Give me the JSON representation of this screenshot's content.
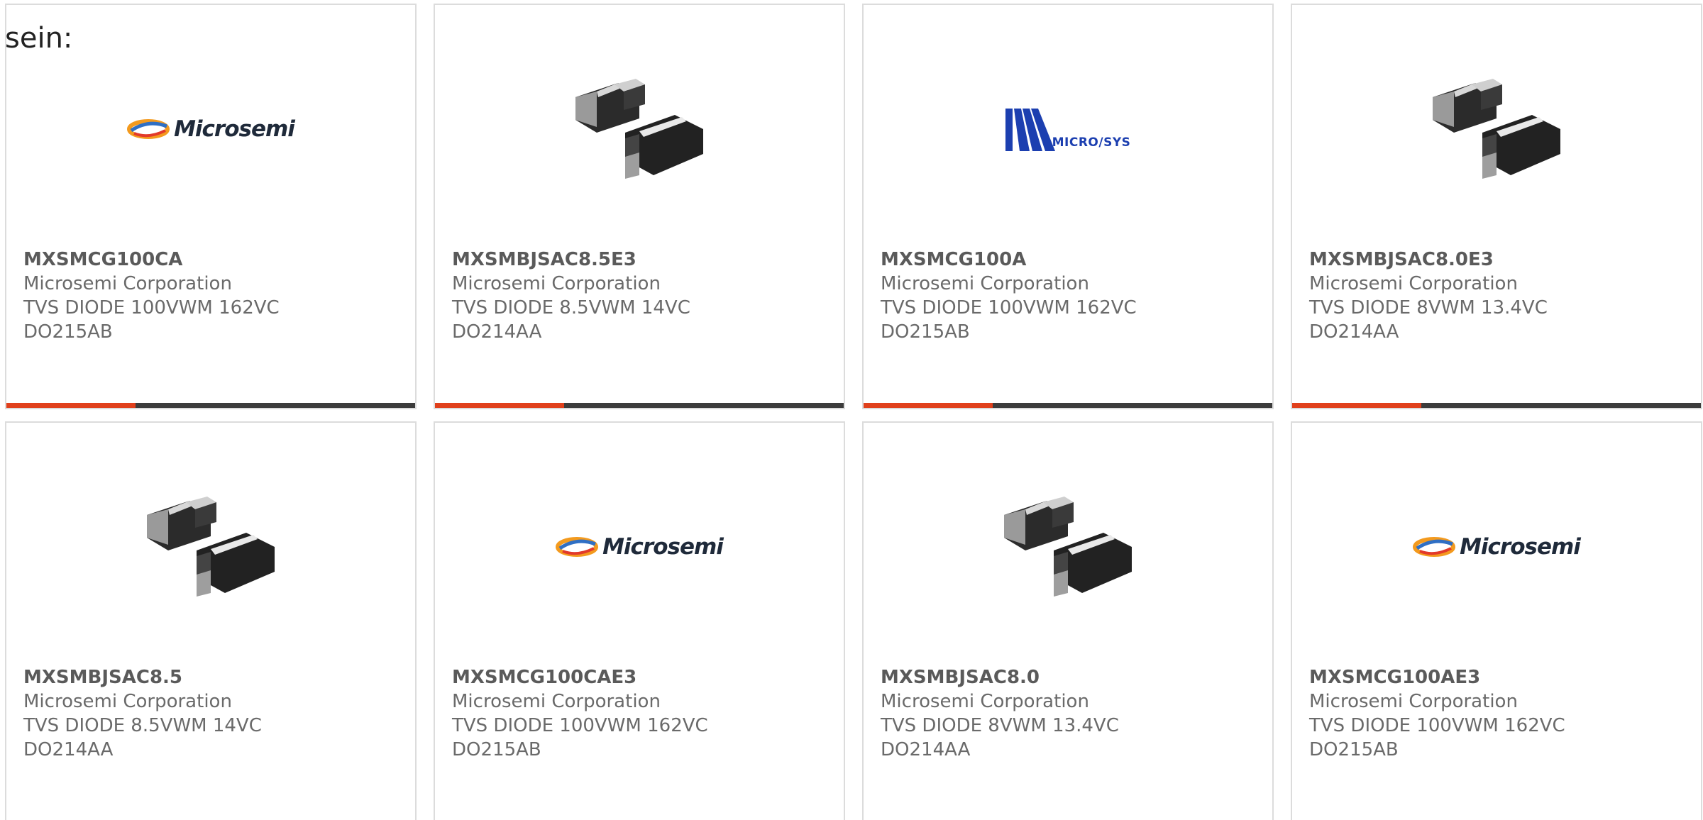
{
  "intro_text": "sein:",
  "brand_colors": {
    "accent": "#e0401c",
    "bar": "#3c3c3c",
    "microsys_blue": "#1c3fb0"
  },
  "products": [
    {
      "part": "MXSMCG100CA",
      "manufacturer": "Microsemi Corporation",
      "description": "TVS DIODE 100VWM 162VC",
      "package": "DO215AB",
      "image": "microsemi-logo"
    },
    {
      "part": "MXSMBJSAC8.5E3",
      "manufacturer": "Microsemi Corporation",
      "description": "TVS DIODE 8.5VWM 14VC",
      "package": "DO214AA",
      "image": "smd-diode-package"
    },
    {
      "part": "MXSMCG100A",
      "manufacturer": "Microsemi Corporation",
      "description": "TVS DIODE 100VWM 162VC",
      "package": "DO215AB",
      "image": "microsys-logo",
      "image_text": "MICRO/SYS"
    },
    {
      "part": "MXSMBJSAC8.0E3",
      "manufacturer": "Microsemi Corporation",
      "description": "TVS DIODE 8VWM 13.4VC",
      "package": "DO214AA",
      "image": "smd-diode-package"
    },
    {
      "part": "MXSMBJSAC8.5",
      "manufacturer": "Microsemi Corporation",
      "description": "TVS DIODE 8.5VWM 14VC",
      "package": "DO214AA",
      "image": "smd-diode-package"
    },
    {
      "part": "MXSMCG100CAE3",
      "manufacturer": "Microsemi Corporation",
      "description": "TVS DIODE 100VWM 162VC",
      "package": "DO215AB",
      "image": "microsemi-logo"
    },
    {
      "part": "MXSMBJSAC8.0",
      "manufacturer": "Microsemi Corporation",
      "description": "TVS DIODE 8VWM 13.4VC",
      "package": "DO214AA",
      "image": "smd-diode-package"
    },
    {
      "part": "MXSMCG100AE3",
      "manufacturer": "Microsemi Corporation",
      "description": "TVS DIODE 100VWM 162VC",
      "package": "DO215AB",
      "image": "microsemi-logo"
    }
  ],
  "logo_text": {
    "microsemi": "Microsemi"
  }
}
